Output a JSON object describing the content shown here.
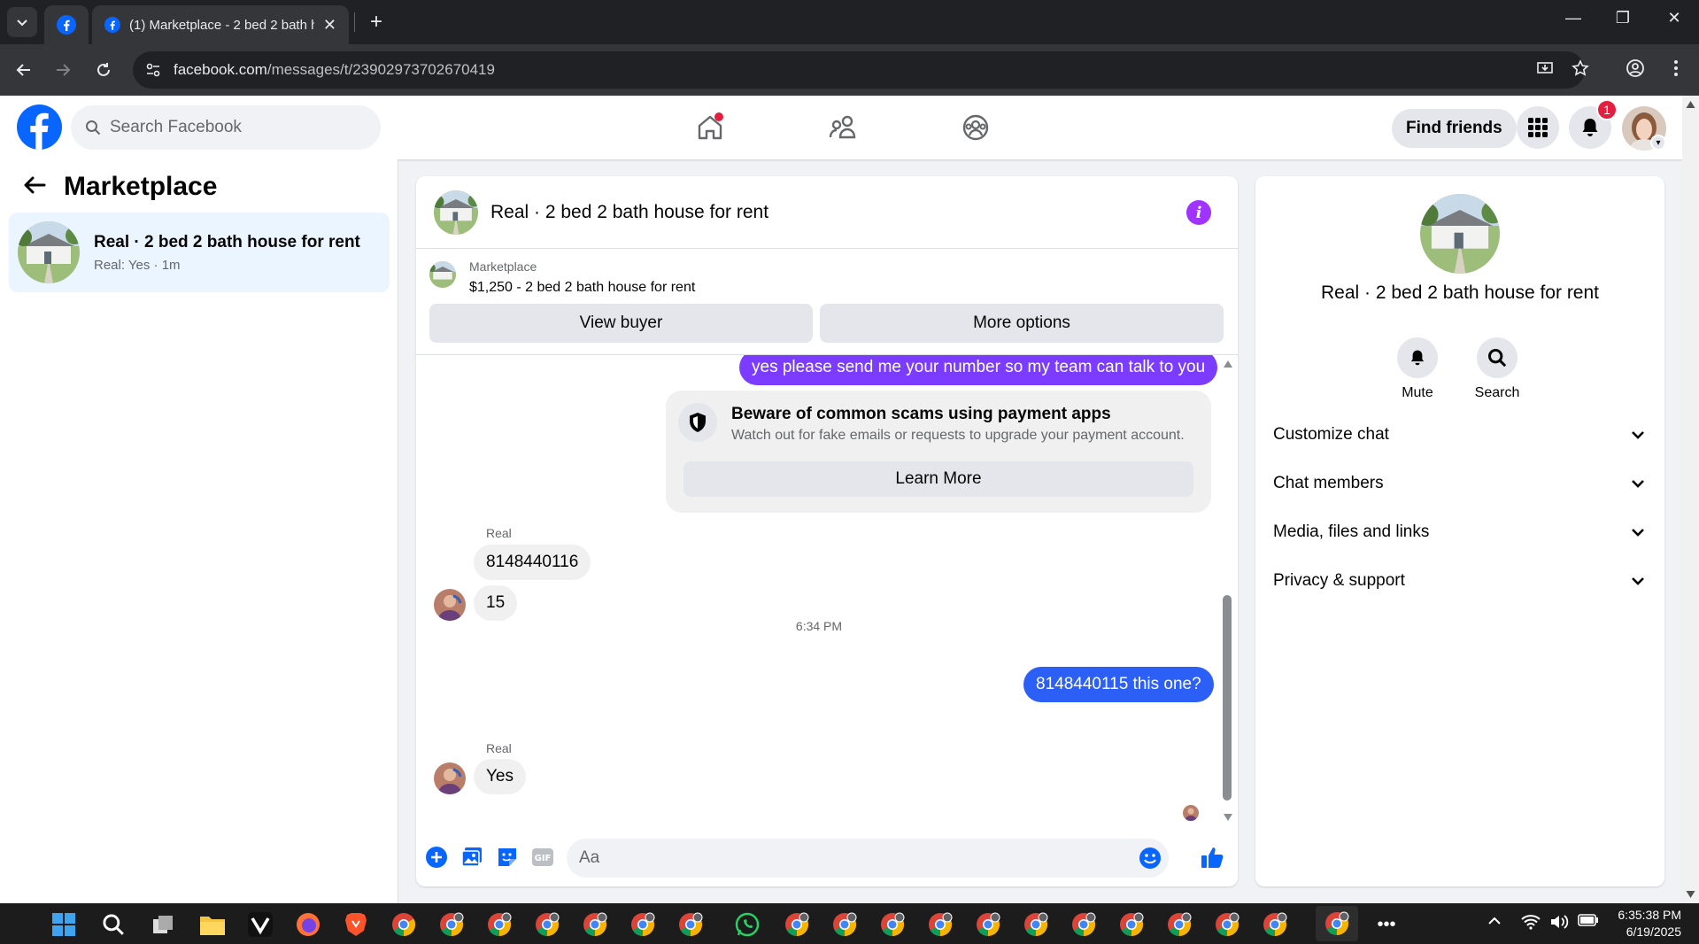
{
  "browser": {
    "tab_title": "(1) Marketplace - 2 bed 2 bath house for rent",
    "url_host": "facebook.com",
    "url_path": "/messages/t/23902973702670419"
  },
  "header": {
    "search_placeholder": "Search Facebook",
    "find_friends": "Find friends",
    "notification_count": "1"
  },
  "left": {
    "title": "Marketplace",
    "item": {
      "name": "Real · 2 bed 2 bath house for rent",
      "subtitle": "Real: Yes · 1m"
    }
  },
  "chat": {
    "title": "Real · 2 bed 2 bath house for rent",
    "listing_source": "Marketplace",
    "listing_desc": "$1,250 - 2 bed 2 bath house for rent",
    "view_buyer": "View buyer",
    "more_options": "More options",
    "messages": {
      "m1": "yes please send me your number so my team can talk to you",
      "scam_title": "Beware of common scams using payment apps",
      "scam_body": "Watch out for fake emails or requests to upgrade your payment account.",
      "learn_more": "Learn More",
      "sender1": "Real",
      "m2": "8148440116",
      "m3": "15",
      "time": "6:34 PM",
      "m4": "8148440115 this one?",
      "sender2": "Real",
      "m5": "Yes"
    },
    "composer_placeholder": "Aa"
  },
  "right": {
    "name": "Real · 2 bed 2 bath house for rent",
    "mute": "Mute",
    "search": "Search",
    "rows": [
      "Customize chat",
      "Chat members",
      "Media, files and links",
      "Privacy & support"
    ]
  },
  "taskbar": {
    "time": "6:35:38 PM",
    "date": "6/19/2025"
  },
  "colors": {
    "fb_blue": "#0866ff",
    "my_bubble": "#7b3cff",
    "my_bubble_latest": "#2b5ff6",
    "info_purple": "#a033ff"
  }
}
